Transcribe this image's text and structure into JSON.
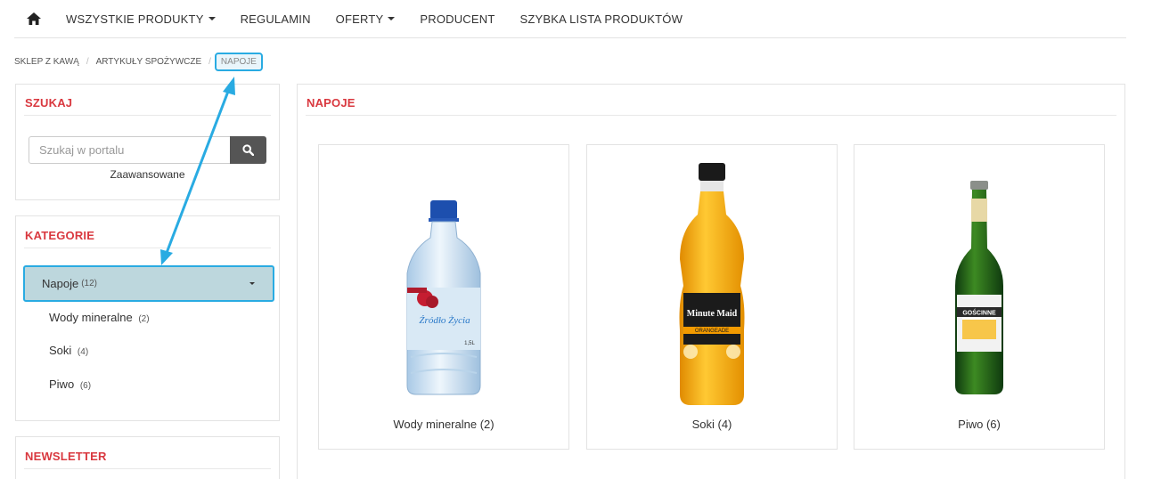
{
  "nav": {
    "home_icon": "home-icon",
    "items": [
      {
        "label": "WSZYSTKIE PRODUKTY",
        "dropdown": true
      },
      {
        "label": "REGULAMIN",
        "dropdown": false
      },
      {
        "label": "OFERTY",
        "dropdown": true
      },
      {
        "label": "PRODUCENT",
        "dropdown": false
      },
      {
        "label": "SZYBKA LISTA PRODUKTÓW",
        "dropdown": false
      }
    ]
  },
  "breadcrumb": {
    "items": [
      "SKLEP Z KAWĄ",
      "ARTYKUŁY SPOŻYWCZE"
    ],
    "current": "NAPOJE",
    "separator": "/"
  },
  "search_panel": {
    "title": "SZUKAJ",
    "placeholder": "Szukaj w portalu",
    "button_icon": "search-icon",
    "advanced_link": "Zaawansowane"
  },
  "categories_panel": {
    "title": "KATEGORIE",
    "active": {
      "label": "Napoje",
      "count": "(12)"
    },
    "subcategories": [
      {
        "label": "Wody mineralne",
        "count": "(2)"
      },
      {
        "label": "Soki",
        "count": "(4)"
      },
      {
        "label": "Piwo",
        "count": "(6)"
      }
    ]
  },
  "newsletter_panel": {
    "title": "NEWSLETTER"
  },
  "main": {
    "title": "NAPOJE",
    "products": [
      {
        "label": "Wody mineralne  (2)",
        "image": "water-bottle-image"
      },
      {
        "label": "Soki  (4)",
        "image": "juice-bottle-image"
      },
      {
        "label": "Piwo  (6)",
        "image": "beer-bottle-image"
      }
    ],
    "bottle_text": {
      "water": "Źródło Życia",
      "water_volume": "1,5L",
      "juice_brand": "Minute Maid",
      "juice_flavor": "ORANGEADE",
      "beer": "GOŚCINNE"
    }
  },
  "colors": {
    "accent_red": "#d9383f",
    "highlight_blue": "#29abe2",
    "active_category_bg": "#bdd7dd",
    "search_button": "#555555"
  }
}
